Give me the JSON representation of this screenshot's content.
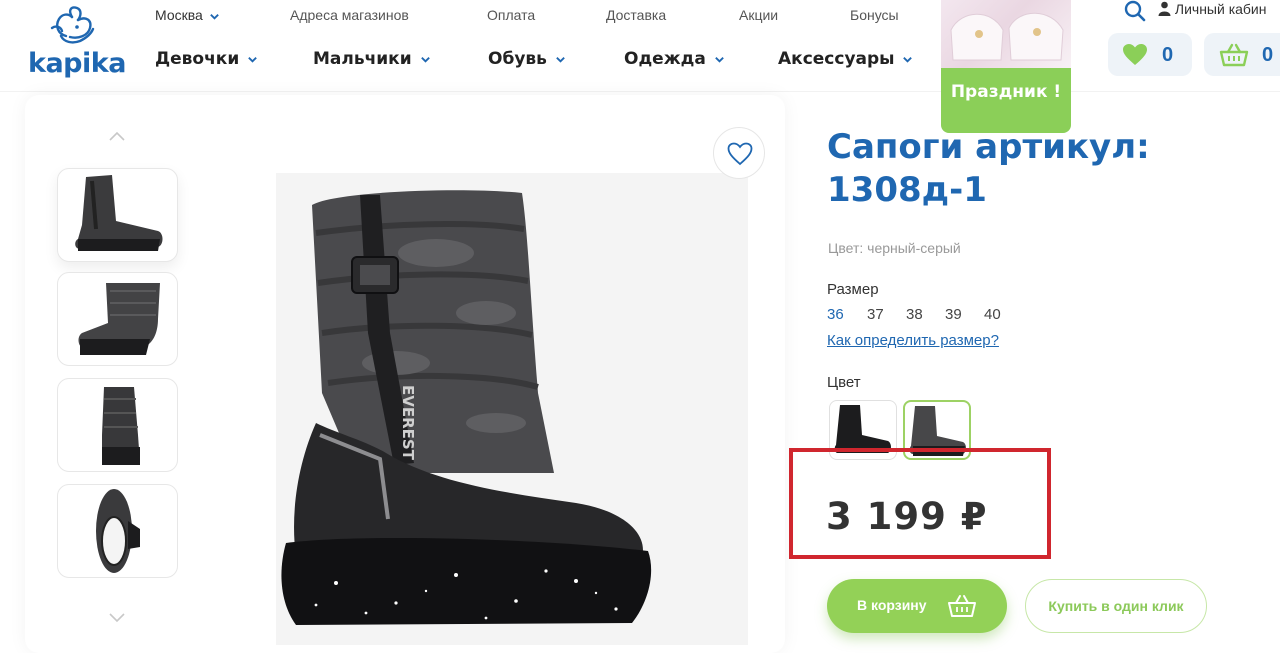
{
  "brand": {
    "name": "kapika",
    "color": "#1f67b1"
  },
  "topbar": {
    "city": "Москва",
    "links": [
      "Адреса магазинов",
      "Оплата",
      "Доставка",
      "Акции",
      "Бонусы"
    ],
    "account_label": "Личный кабин"
  },
  "nav": {
    "items": [
      "Девочки",
      "Мальчики",
      "Обувь",
      "Одежда",
      "Аксессуары"
    ]
  },
  "promo": {
    "label": "Праздник !",
    "color": "#8bcf58"
  },
  "counters": {
    "favorites": "0",
    "cart": "0"
  },
  "product": {
    "title": "Сапоги артикул: 1308д-1",
    "color_line": "Цвет: черный-серый",
    "size_label": "Размер",
    "sizes": [
      "36",
      "37",
      "38",
      "39",
      "40"
    ],
    "selected_size": "36",
    "size_help": "Как определить размер?",
    "color_label": "Цвет",
    "price": "3 199 ₽",
    "boot_brand": "EVEREST",
    "add_to_cart": "В корзину",
    "buy_one_click": "Купить в один клик"
  },
  "colors": {
    "accent_green": "#93d157",
    "highlight_red": "#d0262e"
  }
}
